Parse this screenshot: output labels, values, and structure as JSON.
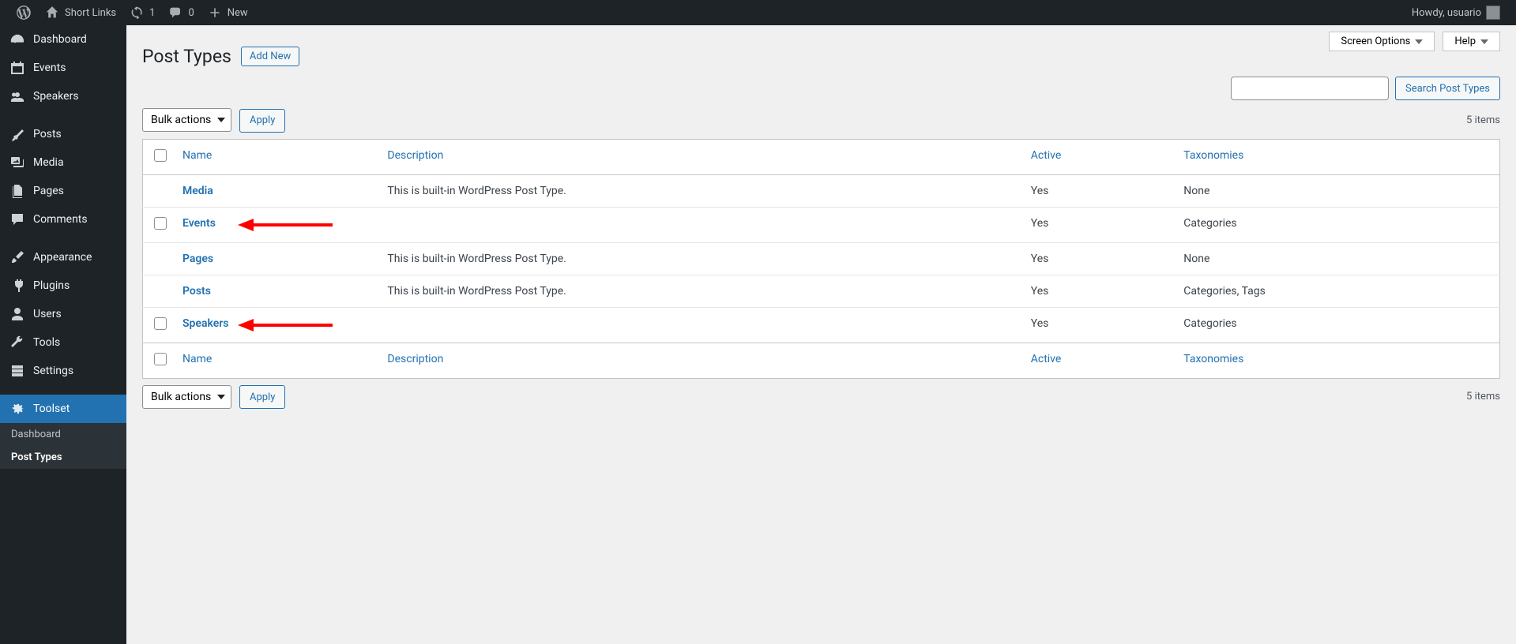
{
  "adminbar": {
    "site": "Short Links",
    "updates": "1",
    "comments": "0",
    "new": "New",
    "howdy": "Howdy, usuario"
  },
  "sidebar": {
    "items": [
      {
        "label": "Dashboard"
      },
      {
        "label": "Events"
      },
      {
        "label": "Speakers"
      },
      {
        "label": "Posts"
      },
      {
        "label": "Media"
      },
      {
        "label": "Pages"
      },
      {
        "label": "Comments"
      },
      {
        "label": "Appearance"
      },
      {
        "label": "Plugins"
      },
      {
        "label": "Users"
      },
      {
        "label": "Tools"
      },
      {
        "label": "Settings"
      },
      {
        "label": "Toolset"
      }
    ],
    "submenu": {
      "dashboard": "Dashboard",
      "posttypes": "Post Types"
    }
  },
  "top": {
    "screen_options": "Screen Options",
    "help": "Help"
  },
  "page": {
    "title": "Post Types",
    "add_new": "Add New"
  },
  "search": {
    "button": "Search Post Types"
  },
  "bulk": {
    "label": "Bulk actions",
    "apply": "Apply"
  },
  "count": "5 items",
  "columns": {
    "name": "Name",
    "description": "Description",
    "active": "Active",
    "taxonomies": "Taxonomies"
  },
  "rows": [
    {
      "name": "Media",
      "desc": "This is built-in WordPress Post Type.",
      "active": "Yes",
      "tax": "None",
      "checkbox": false
    },
    {
      "name": "Events",
      "desc": "",
      "active": "Yes",
      "tax": "Categories",
      "checkbox": true,
      "arrow": true
    },
    {
      "name": "Pages",
      "desc": "This is built-in WordPress Post Type.",
      "active": "Yes",
      "tax": "None",
      "checkbox": false
    },
    {
      "name": "Posts",
      "desc": "This is built-in WordPress Post Type.",
      "active": "Yes",
      "tax": "Categories, Tags",
      "checkbox": false
    },
    {
      "name": "Speakers",
      "desc": "",
      "active": "Yes",
      "tax": "Categories",
      "checkbox": true,
      "arrow": true
    }
  ]
}
